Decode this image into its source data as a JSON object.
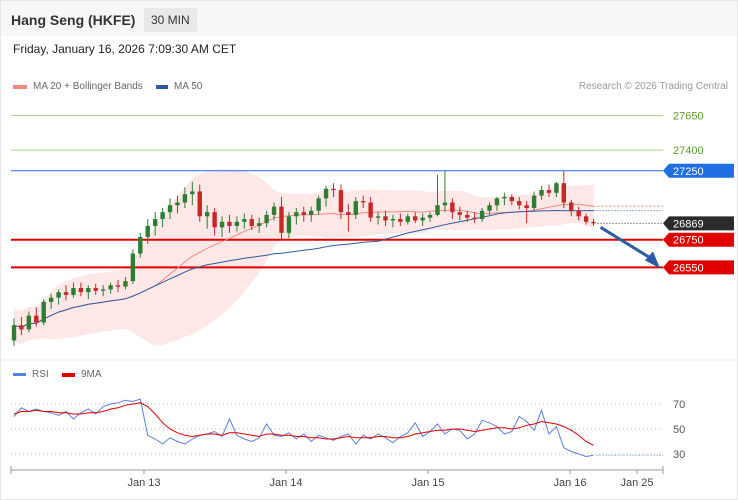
{
  "header": {
    "title": "Hang Seng (HKFE)",
    "interval": "30 MIN"
  },
  "datetime": "Friday, January 16, 2026 7:09:30 AM CET",
  "legend": {
    "ma20": {
      "label": "MA 20 + Bollinger Bands",
      "color": "#f28b82"
    },
    "ma50": {
      "label": "MA 50",
      "color": "#2f5aa0"
    },
    "credit": "Research © 2026 Trading Central"
  },
  "rsi_legend": {
    "rsi": {
      "label": "RSI",
      "color": "#5b7fe0"
    },
    "ma9": {
      "label": "9MA",
      "color": "#e00000"
    }
  },
  "chart_data": [
    {
      "type": "candlestick",
      "title": "Hang Seng (HKFE) 30 MIN",
      "ylim": [
        25900,
        27850
      ],
      "x_ticks": [
        "Jan 13",
        "Jan 14",
        "Jan 15",
        "Jan 16",
        "Jan 25"
      ],
      "current_price": "26869",
      "levels": [
        {
          "value": 27650,
          "label": "27650",
          "kind": "target",
          "color": "#6bb744"
        },
        {
          "value": 27400,
          "label": "27400",
          "kind": "target",
          "color": "#6bb744"
        },
        {
          "value": 27250,
          "label": "27250",
          "kind": "pivot",
          "color": "#1f6fe5"
        },
        {
          "value": 26750,
          "label": "26750",
          "kind": "support",
          "color": "#e00000"
        },
        {
          "value": 26550,
          "label": "26550",
          "kind": "support",
          "color": "#e00000"
        }
      ],
      "candles": [
        [
          26020,
          26180,
          25980,
          26130
        ],
        [
          26130,
          26190,
          26060,
          26100
        ],
        [
          26100,
          26230,
          26080,
          26200
        ],
        [
          26200,
          26260,
          26120,
          26150
        ],
        [
          26150,
          26320,
          26130,
          26300
        ],
        [
          26300,
          26360,
          26250,
          26330
        ],
        [
          26330,
          26390,
          26280,
          26370
        ],
        [
          26370,
          26420,
          26310,
          26350
        ],
        [
          26350,
          26440,
          26330,
          26400
        ],
        [
          26400,
          26440,
          26340,
          26370
        ],
        [
          26370,
          26420,
          26320,
          26400
        ],
        [
          26400,
          26430,
          26350,
          26380
        ],
        [
          26380,
          26420,
          26340,
          26390
        ],
        [
          26390,
          26440,
          26360,
          26420
        ],
        [
          26420,
          26460,
          26370,
          26410
        ],
        [
          26410,
          26480,
          26390,
          26450
        ],
        [
          26450,
          26680,
          26430,
          26650
        ],
        [
          26650,
          26800,
          26620,
          26770
        ],
        [
          26770,
          26900,
          26720,
          26850
        ],
        [
          26850,
          26950,
          26780,
          26900
        ],
        [
          26900,
          26980,
          26840,
          26950
        ],
        [
          26950,
          27050,
          26900,
          27000
        ],
        [
          27000,
          27070,
          26940,
          27020
        ],
        [
          27020,
          27130,
          26980,
          27080
        ],
        [
          27080,
          27170,
          27000,
          27100
        ],
        [
          27100,
          27150,
          26880,
          26920
        ],
        [
          26920,
          27000,
          26830,
          26950
        ],
        [
          26950,
          26980,
          26780,
          26840
        ],
        [
          26840,
          26920,
          26770,
          26880
        ],
        [
          26880,
          26930,
          26800,
          26850
        ],
        [
          26850,
          26920,
          26810,
          26880
        ],
        [
          26880,
          26940,
          26830,
          26900
        ],
        [
          26900,
          26930,
          26820,
          26850
        ],
        [
          26850,
          26910,
          26800,
          26870
        ],
        [
          26870,
          26960,
          26840,
          26930
        ],
        [
          26930,
          27020,
          26890,
          26990
        ],
        [
          26990,
          27060,
          26750,
          26800
        ],
        [
          26800,
          26950,
          26760,
          26920
        ],
        [
          26920,
          26980,
          26860,
          26950
        ],
        [
          26950,
          26990,
          26880,
          26930
        ],
        [
          26930,
          26990,
          26880,
          26960
        ],
        [
          26960,
          27070,
          26930,
          27050
        ],
        [
          27050,
          27140,
          26990,
          27120
        ],
        [
          27120,
          27160,
          27060,
          27110
        ],
        [
          27110,
          27150,
          26900,
          26950
        ],
        [
          26950,
          27010,
          26810,
          26930
        ],
        [
          26930,
          27060,
          26900,
          27030
        ],
        [
          27030,
          27070,
          26980,
          27020
        ],
        [
          27020,
          27060,
          26880,
          26910
        ],
        [
          26910,
          26950,
          26860,
          26920
        ],
        [
          26920,
          26960,
          26850,
          26890
        ],
        [
          26890,
          26930,
          26840,
          26900
        ],
        [
          26900,
          26940,
          26850,
          26880
        ],
        [
          26880,
          26940,
          26860,
          26920
        ],
        [
          26920,
          26950,
          26870,
          26890
        ],
        [
          26890,
          26940,
          26850,
          26910
        ],
        [
          26910,
          26950,
          26880,
          26930
        ],
        [
          26930,
          27220,
          26920,
          27000
        ],
        [
          27000,
          27250,
          26950,
          27020
        ],
        [
          27020,
          27050,
          26900,
          26950
        ],
        [
          26950,
          26990,
          26890,
          26930
        ],
        [
          26930,
          26960,
          26880,
          26910
        ],
        [
          26910,
          26950,
          26870,
          26900
        ],
        [
          26900,
          26980,
          26880,
          26960
        ],
        [
          26960,
          27020,
          26930,
          27000
        ],
        [
          27000,
          27060,
          26960,
          27050
        ],
        [
          27050,
          27090,
          27000,
          27060
        ],
        [
          27060,
          27080,
          27000,
          27030
        ],
        [
          27030,
          27060,
          26970,
          27000
        ],
        [
          27000,
          27030,
          26870,
          26980
        ],
        [
          26980,
          27100,
          26960,
          27070
        ],
        [
          27070,
          27140,
          27040,
          27110
        ],
        [
          27110,
          27150,
          27060,
          27090
        ],
        [
          27090,
          27170,
          27060,
          27160
        ],
        [
          27160,
          27250,
          26980,
          27020
        ],
        [
          27020,
          27040,
          26920,
          26960
        ],
        [
          26960,
          26990,
          26890,
          26920
        ],
        [
          26920,
          26940,
          26860,
          26880
        ],
        [
          26880,
          26900,
          26850,
          26869
        ]
      ]
    },
    {
      "type": "line",
      "title": "RSI",
      "ylim": [
        25,
        85
      ],
      "y_ticks": [
        "70",
        "50",
        "30"
      ],
      "series": [
        {
          "name": "RSI",
          "values": [
            60,
            67,
            64,
            66,
            64,
            63,
            61,
            64,
            58,
            63,
            66,
            62,
            68,
            70,
            71,
            73,
            72,
            74,
            45,
            42,
            38,
            43,
            40,
            38,
            42,
            45,
            46,
            48,
            44,
            58,
            45,
            42,
            40,
            43,
            54,
            45,
            44,
            47,
            42,
            46,
            40,
            45,
            43,
            41,
            44,
            46,
            38,
            45,
            42,
            46,
            43,
            39,
            44,
            47,
            55,
            44,
            48,
            54,
            46,
            50,
            49,
            42,
            46,
            57,
            55,
            52,
            46,
            48,
            60,
            56,
            49,
            65,
            46,
            52,
            35,
            32,
            30,
            28,
            29
          ]
        },
        {
          "name": "9MA",
          "values": [
            62,
            64,
            64,
            65,
            64,
            64,
            63,
            63,
            62,
            62,
            63,
            63,
            64,
            66,
            67,
            69,
            70,
            71,
            68,
            62,
            55,
            50,
            47,
            45,
            44,
            45,
            46,
            46,
            45,
            47,
            47,
            46,
            45,
            44,
            46,
            46,
            45,
            45,
            44,
            44,
            43,
            43,
            42,
            42,
            43,
            44,
            43,
            43,
            43,
            44,
            44,
            43,
            43,
            44,
            46,
            47,
            48,
            49,
            49,
            50,
            50,
            49,
            48,
            49,
            50,
            51,
            51,
            50,
            51,
            53,
            54,
            56,
            55,
            54,
            52,
            49,
            45,
            40,
            37
          ]
        }
      ]
    }
  ]
}
